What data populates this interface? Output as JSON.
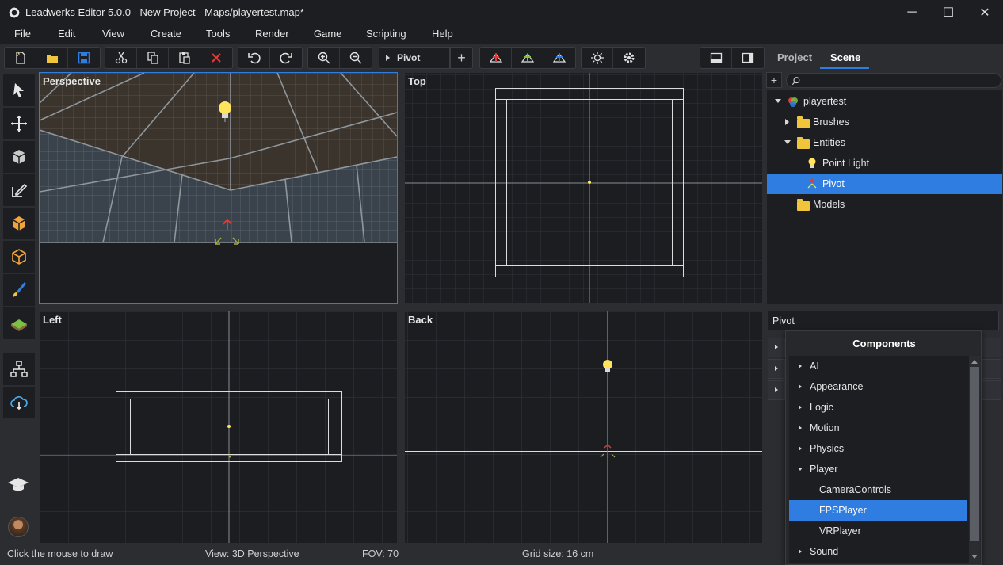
{
  "window": {
    "title": "Leadwerks Editor 5.0.0 - New Project - Maps/playertest.map*",
    "minimize": "─",
    "maximize": "☐",
    "close": "✕"
  },
  "menu": [
    "File",
    "Edit",
    "View",
    "Create",
    "Tools",
    "Render",
    "Game",
    "Scripting",
    "Help"
  ],
  "toolbar": {
    "object_type": "Pivot",
    "add_label": "+"
  },
  "viewports": {
    "perspective": "Perspective",
    "top": "Top",
    "left": "Left",
    "back": "Back"
  },
  "right_panel": {
    "tabs": [
      "Project",
      "Scene"
    ],
    "active_tab": "Scene",
    "add_label": "+",
    "tree": [
      {
        "label": "playertest",
        "icon": "scene-icon"
      },
      {
        "label": "Brushes",
        "icon": "folder-icon"
      },
      {
        "label": "Entities",
        "icon": "folder-icon"
      },
      {
        "label": "Point Light",
        "icon": "light-bulb-icon"
      },
      {
        "label": "Pivot",
        "icon": "pivot-icon",
        "selected": true
      },
      {
        "label": "Models",
        "icon": "folder-icon"
      }
    ],
    "entity_name": "Pivot"
  },
  "components": {
    "title": "Components",
    "items": [
      "AI",
      "Appearance",
      "Logic",
      "Motion",
      "Physics",
      "Player",
      "CameraControls",
      "FPSPlayer",
      "VRPlayer",
      "Sound"
    ],
    "selected": "FPSPlayer"
  },
  "status": {
    "hint": "Click the mouse to draw",
    "view": "View: 3D Perspective",
    "fov": "FOV: 70",
    "grid": "Grid size: 16 cm"
  },
  "colors": {
    "accent": "#2f7de1",
    "panel_dark": "#1d1e22",
    "background": "#2b2d31",
    "folder": "#f0c43b"
  }
}
